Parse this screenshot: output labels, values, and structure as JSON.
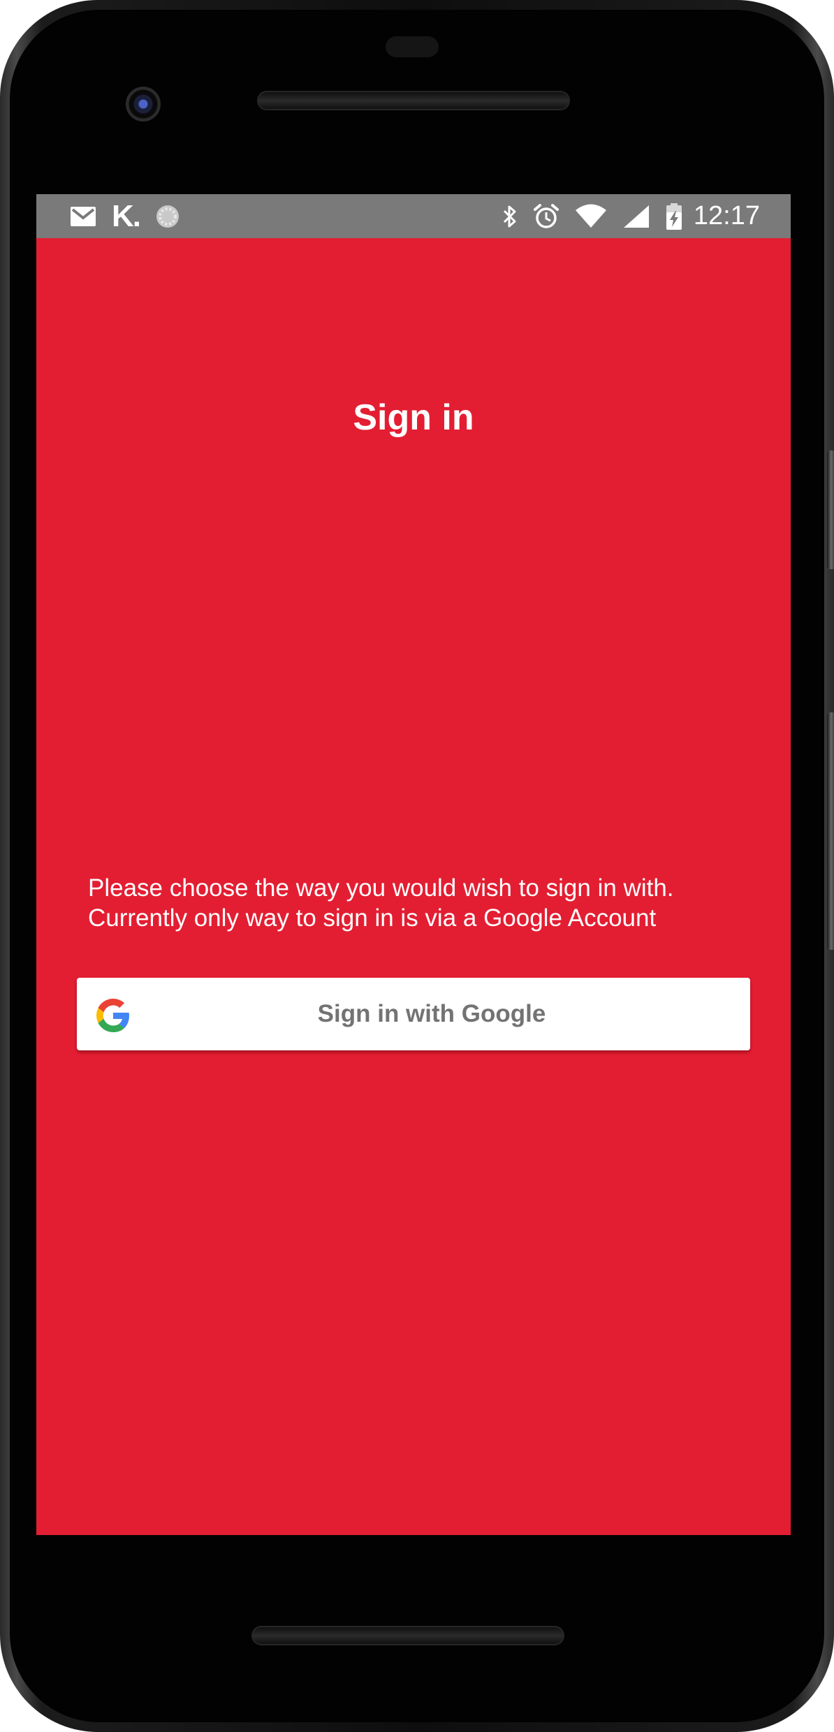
{
  "status_bar": {
    "time": "12:17",
    "left_icons": [
      "gmail-icon",
      "k-app-icon",
      "loading-circle-icon"
    ],
    "right_icons": [
      "bluetooth-icon",
      "alarm-icon",
      "wifi-icon",
      "cell-signal-icon",
      "battery-charging-icon"
    ],
    "k_logo_text": "K."
  },
  "screen": {
    "title": "Sign in",
    "instructions_line1": "Please choose the way you would wish to sign in with.",
    "instructions_line2": "Currently only way to sign in is via a Google Account",
    "google_button": {
      "label": "Sign in with Google",
      "icon": "google-g-icon"
    },
    "background_color": "#e31e32",
    "status_bar_color": "#7a7a7a"
  }
}
